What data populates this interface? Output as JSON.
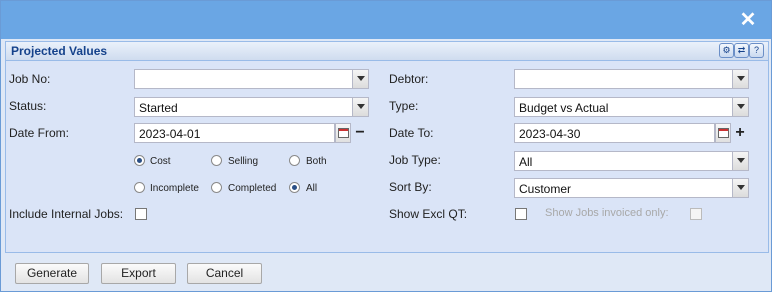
{
  "window": {
    "close_symbol": "✕"
  },
  "panel": {
    "title": "Projected Values",
    "tools": [
      {
        "icon": "gear-icon",
        "glyph": "⚙"
      },
      {
        "icon": "refresh-icon",
        "glyph": "⇄"
      },
      {
        "icon": "help-icon",
        "glyph": "?"
      }
    ]
  },
  "form": {
    "job_no": {
      "label": "Job No:",
      "value": ""
    },
    "status": {
      "label": "Status:",
      "value": "Started"
    },
    "date_from": {
      "label": "Date From:",
      "value": "2023-04-01",
      "adjust": "−"
    },
    "type_radios": {
      "options": [
        "Cost",
        "Selling",
        "Both"
      ],
      "selected": "Cost"
    },
    "state_radios": {
      "options": [
        "Incomplete",
        "Completed",
        "All"
      ],
      "selected": "All"
    },
    "include_internal": {
      "label": "Include Internal Jobs:",
      "checked": false
    },
    "debtor": {
      "label": "Debtor:",
      "value": ""
    },
    "type": {
      "label": "Type:",
      "value": "Budget vs Actual"
    },
    "date_to": {
      "label": "Date To:",
      "value": "2023-04-30",
      "adjust": "+"
    },
    "job_type": {
      "label": "Job Type:",
      "value": "All"
    },
    "sort_by": {
      "label": "Sort By:",
      "value": "Customer"
    },
    "show_excl_qt": {
      "label": "Show Excl QT:",
      "checked": false
    },
    "show_invoiced_only": {
      "label": "Show Jobs invoiced only:",
      "checked": false,
      "disabled": true
    }
  },
  "buttons": {
    "generate": "Generate",
    "export": "Export",
    "cancel": "Cancel"
  }
}
